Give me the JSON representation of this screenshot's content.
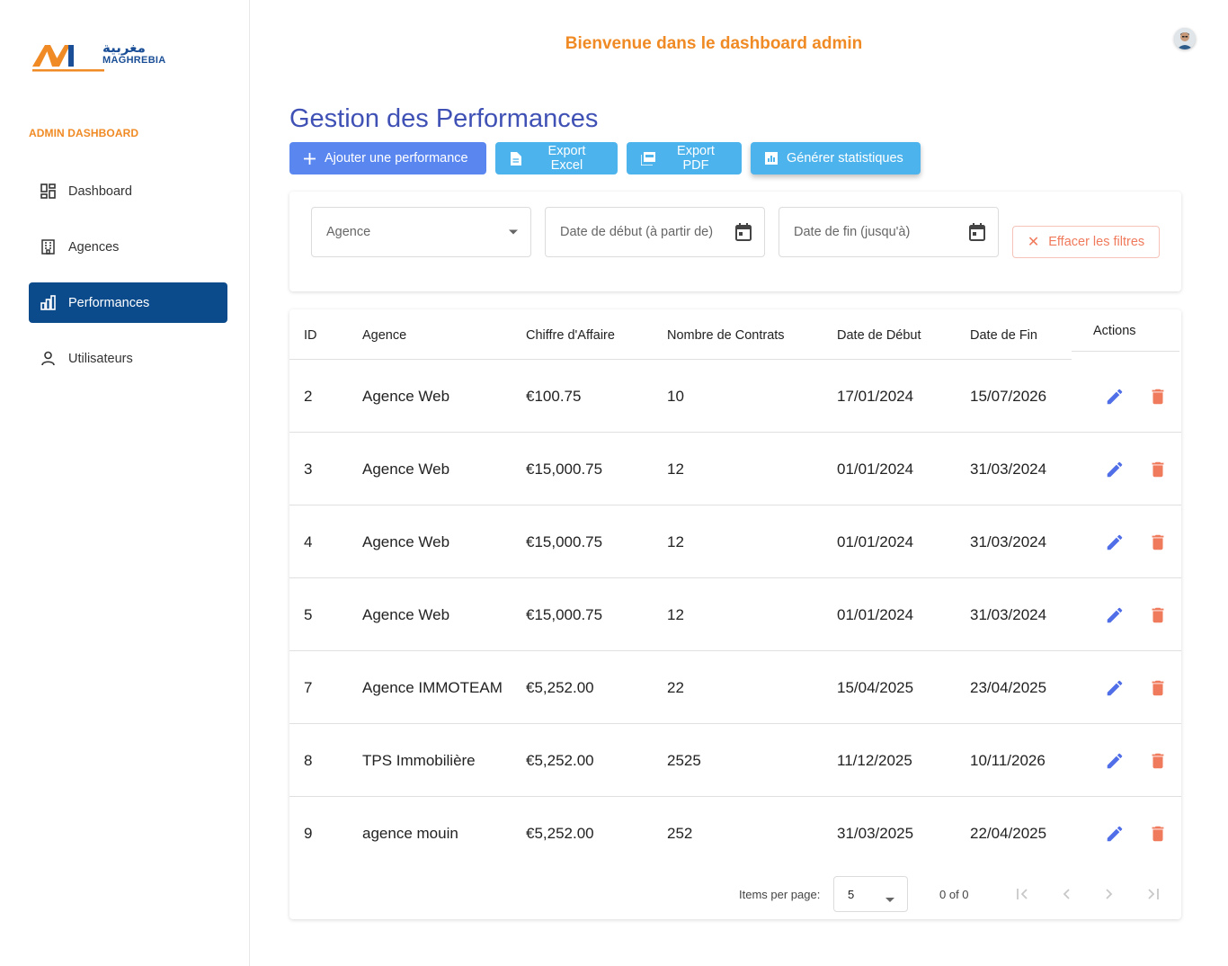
{
  "sidebar": {
    "logo_arabic": "مغربية",
    "logo_latin": "MAGHREBIA",
    "section_label": "ADMIN DASHBOARD",
    "items": [
      {
        "label": "Dashboard",
        "icon": "dashboard-icon",
        "active": false
      },
      {
        "label": "Agences",
        "icon": "building-icon",
        "active": false
      },
      {
        "label": "Performances",
        "icon": "bar-chart-icon",
        "active": true
      },
      {
        "label": "Utilisateurs",
        "icon": "user-icon",
        "active": false
      }
    ]
  },
  "header": {
    "welcome": "Bienvenue dans le dashboard admin"
  },
  "page": {
    "title": "Gestion des Performances",
    "buttons": {
      "add": "Ajouter une performance",
      "excel": "Export Excel",
      "pdf": "Export PDF",
      "stats": "Générer statistiques"
    }
  },
  "filters": {
    "agence_placeholder": "Agence",
    "start_placeholder": "Date de début (à partir de)",
    "end_placeholder": "Date de fin (jusqu'à)",
    "clear_label": "Effacer les filtres"
  },
  "table": {
    "headers": {
      "id": "ID",
      "agence": "Agence",
      "ca": "Chiffre d'Affaire",
      "contrats": "Nombre de Contrats",
      "debut": "Date de Début",
      "fin": "Date de Fin",
      "actions": "Actions"
    },
    "rows": [
      {
        "id": "2",
        "agence": "Agence Web",
        "ca": "€100.75",
        "contrats": "10",
        "debut": "17/01/2024",
        "fin": "15/07/2026"
      },
      {
        "id": "3",
        "agence": "Agence Web",
        "ca": "€15,000.75",
        "contrats": "12",
        "debut": "01/01/2024",
        "fin": "31/03/2024"
      },
      {
        "id": "4",
        "agence": "Agence Web",
        "ca": "€15,000.75",
        "contrats": "12",
        "debut": "01/01/2024",
        "fin": "31/03/2024"
      },
      {
        "id": "5",
        "agence": "Agence Web",
        "ca": "€15,000.75",
        "contrats": "12",
        "debut": "01/01/2024",
        "fin": "31/03/2024"
      },
      {
        "id": "7",
        "agence": "Agence IMMOTEAM",
        "ca": "€5,252.00",
        "contrats": "22",
        "debut": "15/04/2025",
        "fin": "23/04/2025"
      },
      {
        "id": "8",
        "agence": "TPS Immobilière",
        "ca": "€5,252.00",
        "contrats": "2525",
        "debut": "11/12/2025",
        "fin": "10/11/2026"
      },
      {
        "id": "9",
        "agence": "agence mouin",
        "ca": "€5,252.00",
        "contrats": "252",
        "debut": "31/03/2025",
        "fin": "22/04/2025"
      }
    ]
  },
  "paginator": {
    "items_per_page_label": "Items per page:",
    "page_size": "5",
    "range_label": "0 of 0"
  },
  "colors": {
    "brand_orange": "#f08a24",
    "brand_blue": "#0b4a8b",
    "title_indigo": "#3f51b5",
    "primary_button": "#5a86f0",
    "info_button": "#4db3ec",
    "edit_icon": "#4f6ee8",
    "delete_icon": "#f07a5c"
  }
}
